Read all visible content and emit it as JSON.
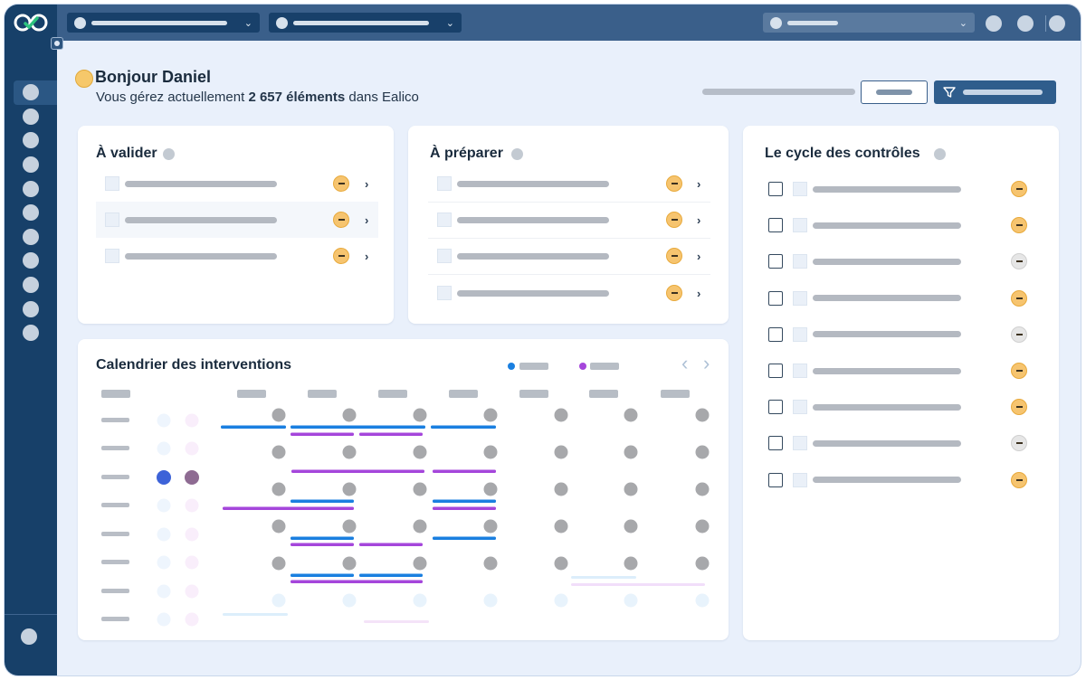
{
  "greeting": {
    "title": "Bonjour Daniel",
    "subtitle_prefix": "Vous gérez actuellement ",
    "subtitle_count": "2 657 éléments",
    "subtitle_suffix": " dans Ealico"
  },
  "cards": {
    "a_valider": {
      "title": "À valider",
      "rows": 3
    },
    "a_preparer": {
      "title": "À préparer",
      "rows": 4
    },
    "cycle": {
      "title": "Le cycle des contrôles",
      "statuses": [
        "pending",
        "pending",
        "neutral",
        "pending",
        "neutral",
        "pending",
        "pending",
        "neutral",
        "pending"
      ]
    },
    "calendar": {
      "title": "Calendrier des interventions"
    }
  },
  "colors": {
    "sidebar": "#174069",
    "topbar": "#3a5f8a",
    "background": "#e9f0fb",
    "accent_blue": "#1a7fe0",
    "accent_purple": "#a546db",
    "badge_yellow": "#f6c46f"
  },
  "icons": [
    "infinity-logo-icon",
    "chevron-down-icon",
    "chevron-right-icon",
    "filter-icon",
    "chevron-left-icon",
    "hand-wave-icon"
  ]
}
